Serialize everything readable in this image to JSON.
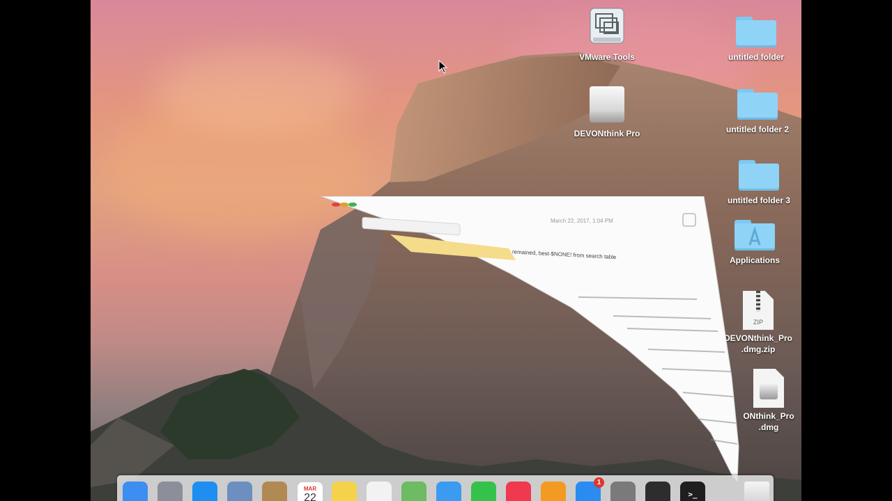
{
  "desktop": {
    "icons": [
      {
        "label": "VMware Tools",
        "kind": "vmware-icon"
      },
      {
        "label": "untitled folder",
        "kind": "folder-icon"
      },
      {
        "label": "DEVONthink Pro",
        "kind": "drive-icon"
      },
      {
        "label": "untitled folder 2",
        "kind": "folder-icon"
      },
      {
        "label": "untitled folder 3",
        "kind": "folder-icon"
      },
      {
        "label": "Applications",
        "kind": "applications-folder-icon"
      },
      {
        "label": "DEVONthink_Pro\n.dmg.zip",
        "kind": "zip-file-icon"
      },
      {
        "label": "ONthink_Pro\n.dmg",
        "kind": "dmg-file-icon"
      }
    ]
  },
  "animating_window": {
    "timestamp": "March 22, 2017, 1:04 PM",
    "line1": "remained, best-$NONE! from search table",
    "zip_text": "ZIP"
  },
  "dock": {
    "apps": [
      {
        "name": "finder-icon",
        "color": "#3d8ef0"
      },
      {
        "name": "launchpad-icon",
        "color": "#8a8f99"
      },
      {
        "name": "safari-icon",
        "color": "#1f8ef1"
      },
      {
        "name": "mail-icon",
        "color": "#6c8fbf"
      },
      {
        "name": "contacts-icon",
        "color": "#b08a52"
      },
      {
        "name": "calendar-icon",
        "color": "#ffffff"
      },
      {
        "name": "notes-icon",
        "color": "#f4d24a"
      },
      {
        "name": "reminders-icon",
        "color": "#f2f2f2"
      },
      {
        "name": "maps-icon",
        "color": "#6dbb63"
      },
      {
        "name": "messages-icon",
        "color": "#3a9bf0"
      },
      {
        "name": "facetime-icon",
        "color": "#35c24a"
      },
      {
        "name": "itunes-icon",
        "color": "#f0384f"
      },
      {
        "name": "ibooks-icon",
        "color": "#f39a22"
      },
      {
        "name": "app-store-icon",
        "color": "#2a8cf0"
      },
      {
        "name": "system-preferences-icon",
        "color": "#7a7a7a"
      },
      {
        "name": "activity-monitor-icon",
        "color": "#2d2d2d"
      },
      {
        "name": "terminal-icon",
        "color": "#1e1e1e"
      },
      {
        "name": "trash-icon",
        "color": "#e8e8e8"
      }
    ],
    "calendar": {
      "month": "MAR",
      "day": "22"
    },
    "app_store_badge": "1",
    "terminal_prompt": ">_"
  }
}
